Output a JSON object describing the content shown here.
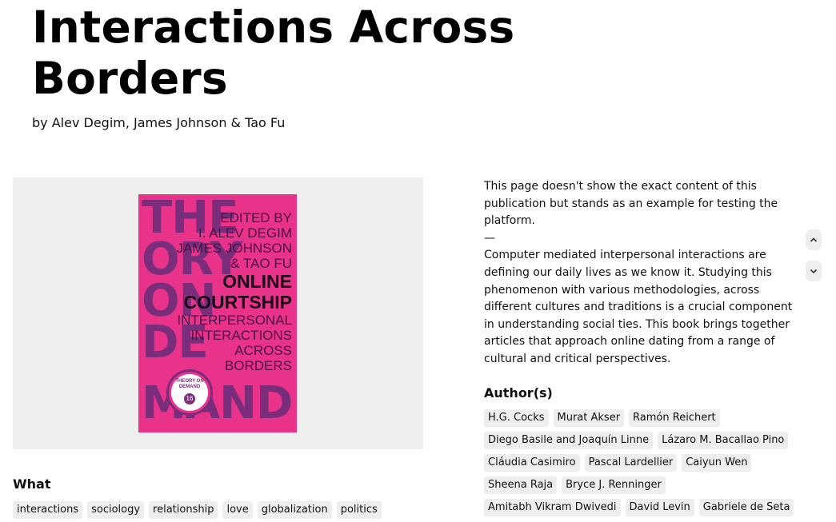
{
  "book": {
    "title_line1": "Interactions Across",
    "title_line2": "Borders",
    "byline": "by Alev Degim, James Johnson & Tao Fu"
  },
  "cover": {
    "big_letters": [
      "THE",
      "ORY",
      "ON",
      "DE",
      "MAND"
    ],
    "edited_by": "EDITED BY",
    "editor1": "I. ALEV DEGIM",
    "editor2": "JAMES JOHNSON",
    "editor3": "& TAO FU",
    "title1": "ONLINE",
    "title2": "COURTSHIP",
    "sub1": "INTERPERSONAL",
    "sub2": "INTERACTIONS",
    "sub3": "ACROSS",
    "sub4": "BORDERS",
    "seal_title": "THEORY ON DEMAND",
    "seal_number": "16",
    "colors": {
      "background": "#e9328a",
      "letters": "#7a2d7a"
    }
  },
  "description": {
    "disclaimer": "This page doesn't show the exact content of this publication but stands as an example for testing the platform.",
    "dash": "—",
    "body": "Computer mediated interpersonal interactions are defining our daily lives as we know it. Studying this phenomenon with various methodologies, across different cultures and traditions is a crucial component in understanding social ties. This book brings together articles that approach online dating from a range of cultural and critical perspectives."
  },
  "scroll": {
    "up_icon": "chevron-up-icon",
    "down_icon": "chevron-down-icon"
  },
  "authors_section": {
    "heading": "Author(s)",
    "authors": [
      "H.G. Cocks",
      "Murat Akser",
      "Ramón Reichert",
      "Diego Basile and Joaquín Linne",
      "Lázaro M. Bacallao Pino",
      "Cláudia Casimiro",
      "Pascal Lardellier",
      "Caiyun Wen",
      "Sheena Raja",
      "Bryce J. Renninger",
      "Amitabh Vikram Dwivedi",
      "David Levin",
      "Gabriele de Seta"
    ]
  },
  "what_section": {
    "heading": "What",
    "tags": [
      "interactions",
      "sociology",
      "relationship",
      "love",
      "globalization",
      "politics"
    ]
  }
}
